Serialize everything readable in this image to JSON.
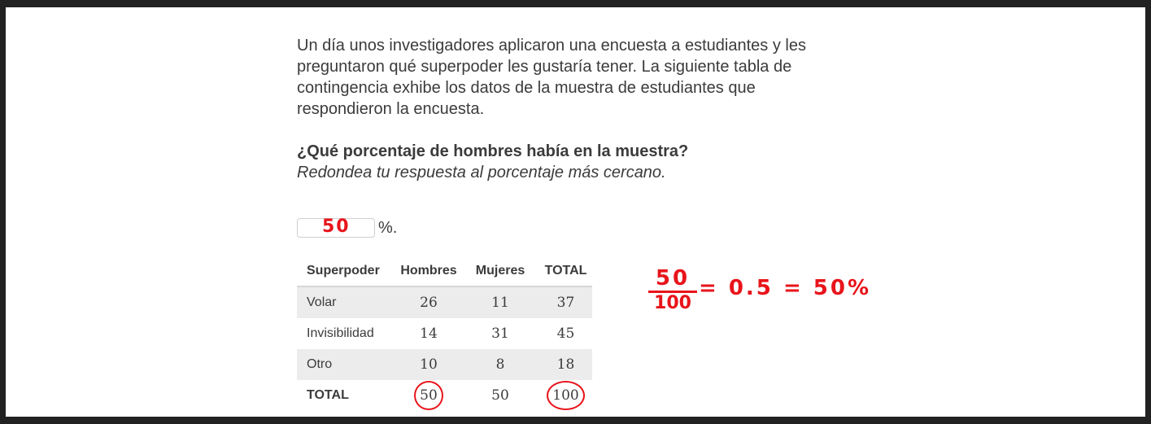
{
  "intro": "Un día unos investigadores aplicaron una encuesta a estudiantes y les preguntaron qué superpoder les gustaría tener. La siguiente tabla de contingencia exhibe los datos de la muestra de estudiantes que respondieron la encuesta.",
  "question": "¿Qué porcentaje de hombres había en la muestra?",
  "hint": "Redondea tu respuesta al porcentaje más cercano.",
  "answer": {
    "value": "50",
    "unit": "%."
  },
  "table": {
    "headers": [
      "Superpoder",
      "Hombres",
      "Mujeres",
      "TOTAL"
    ],
    "rows": [
      [
        "Volar",
        "26",
        "11",
        "37"
      ],
      [
        "Invisibilidad",
        "14",
        "31",
        "45"
      ],
      [
        "Otro",
        "10",
        "8",
        "18"
      ],
      [
        "TOTAL",
        "50",
        "50",
        "100"
      ]
    ]
  },
  "scratch": {
    "numerator": "50",
    "denominator": "100",
    "rest": "= 0.5 = 50%"
  },
  "colors": {
    "ink": "#e8141b",
    "text": "#3b3b3b",
    "row_shade": "#ececec"
  }
}
